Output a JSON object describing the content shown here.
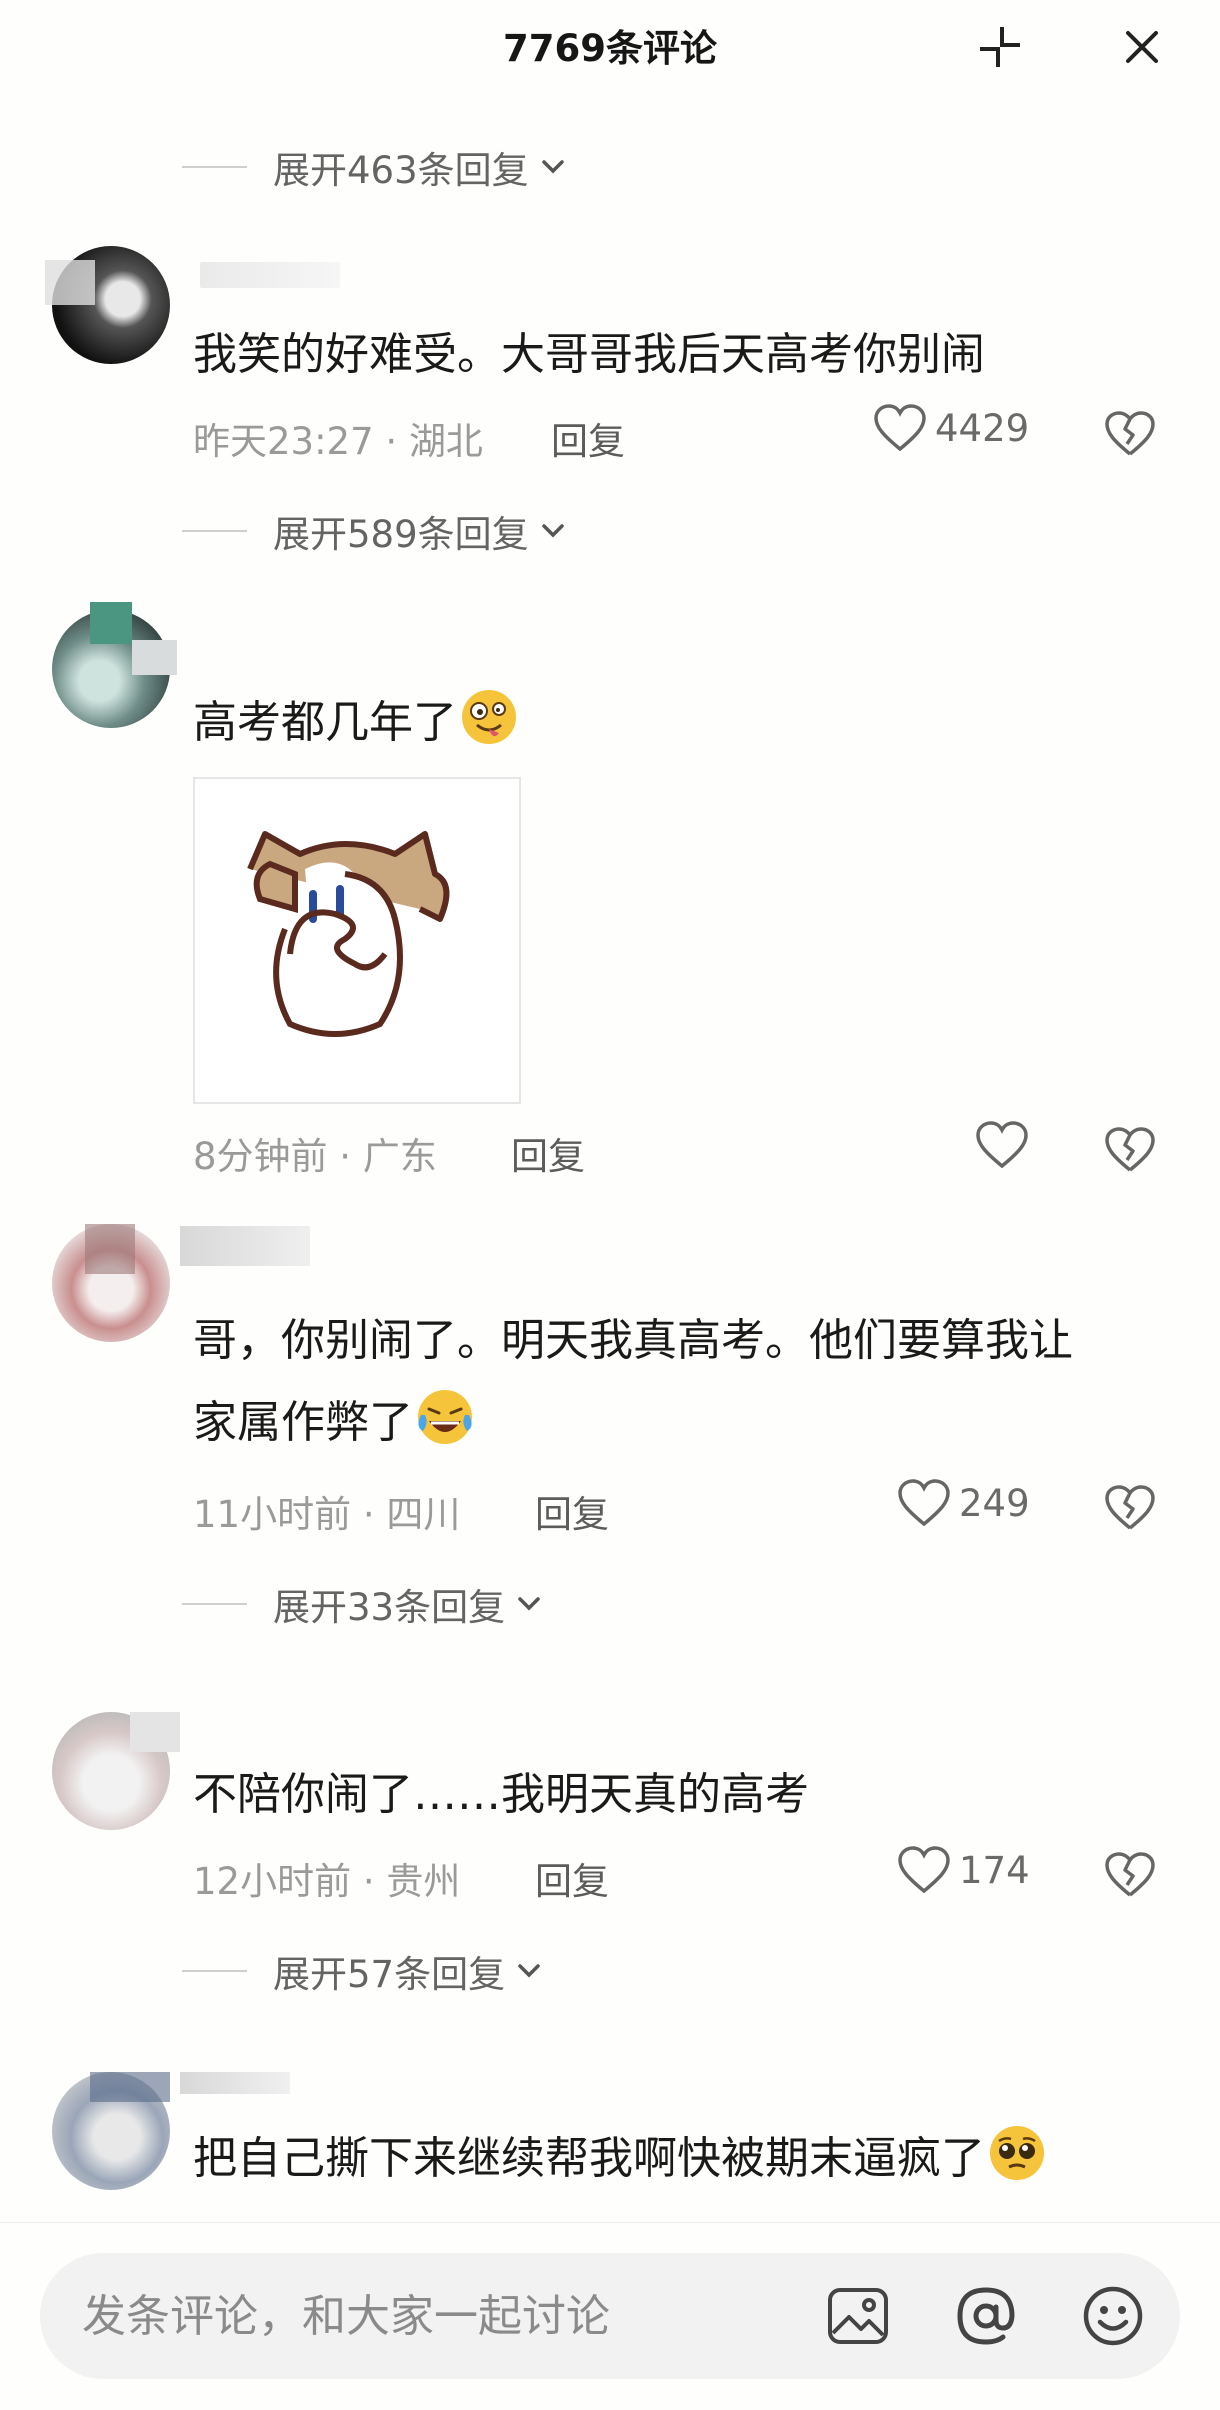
{
  "header": {
    "title": "7769条评论"
  },
  "expand_top": {
    "label": "展开463条回复"
  },
  "comments": [
    {
      "text": "我笑的好难受。大哥哥我后天高考你别闹",
      "time": "昨天23:27",
      "location": "湖北",
      "meta_sep": " · ",
      "reply_label": "回复",
      "likes": "4429",
      "expand_label": "展开589条回复"
    },
    {
      "text": "高考都几年了",
      "emoji": "crazy-face",
      "time": "8分钟前",
      "location": "广东",
      "meta_sep": " · ",
      "reply_label": "回复",
      "likes": ""
    },
    {
      "text_line1": "哥，你别闹了。明天我真高考。他们要算我让",
      "text_line2": "家属作弊了",
      "emoji": "laugh-crying-face",
      "time": "11小时前",
      "location": "四川",
      "meta_sep": " · ",
      "reply_label": "回复",
      "likes": "249",
      "expand_label": "展开33条回复"
    },
    {
      "text": "不陪你闹了……我明天真的高考",
      "time": "12小时前",
      "location": "贵州",
      "meta_sep": " · ",
      "reply_label": "回复",
      "likes": "174",
      "expand_label": "展开57条回复"
    },
    {
      "text": "把自己撕下来继续帮我啊快被期末逼疯了",
      "emoji": "pleading-face"
    }
  ],
  "bottom_bar": {
    "placeholder": "发条评论，和大家一起讨论",
    "icons": [
      "image-icon",
      "at-icon",
      "emoji-icon"
    ]
  },
  "colors": {
    "background": "#fefefc",
    "meta_gray": "#9a9a9a",
    "input_bg": "#f2f2f2"
  }
}
